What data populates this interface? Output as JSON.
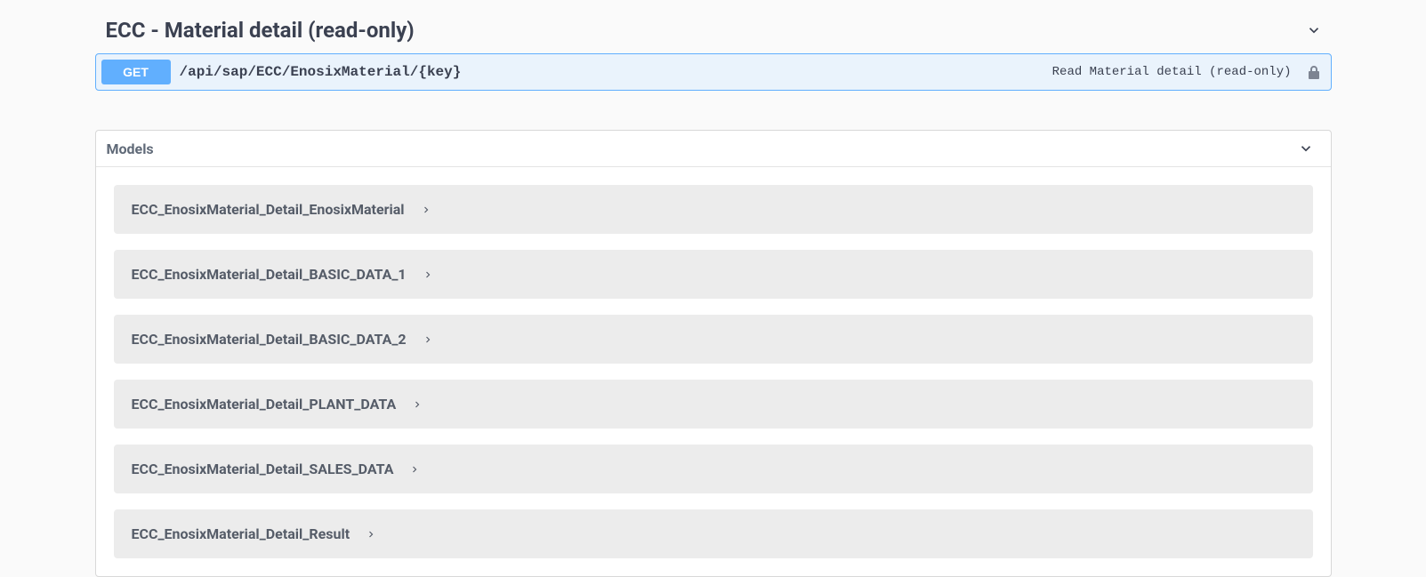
{
  "section": {
    "title": "ECC - Material detail (read-only)"
  },
  "endpoint": {
    "method": "GET",
    "path": "/api/sap/ECC/EnosixMaterial/{key}",
    "description": "Read Material detail (read-only)"
  },
  "models": {
    "title": "Models",
    "items": [
      {
        "name": "ECC_EnosixMaterial_Detail_EnosixMaterial"
      },
      {
        "name": "ECC_EnosixMaterial_Detail_BASIC_DATA_1"
      },
      {
        "name": "ECC_EnosixMaterial_Detail_BASIC_DATA_2"
      },
      {
        "name": "ECC_EnosixMaterial_Detail_PLANT_DATA"
      },
      {
        "name": "ECC_EnosixMaterial_Detail_SALES_DATA"
      },
      {
        "name": "ECC_EnosixMaterial_Detail_Result"
      }
    ]
  }
}
